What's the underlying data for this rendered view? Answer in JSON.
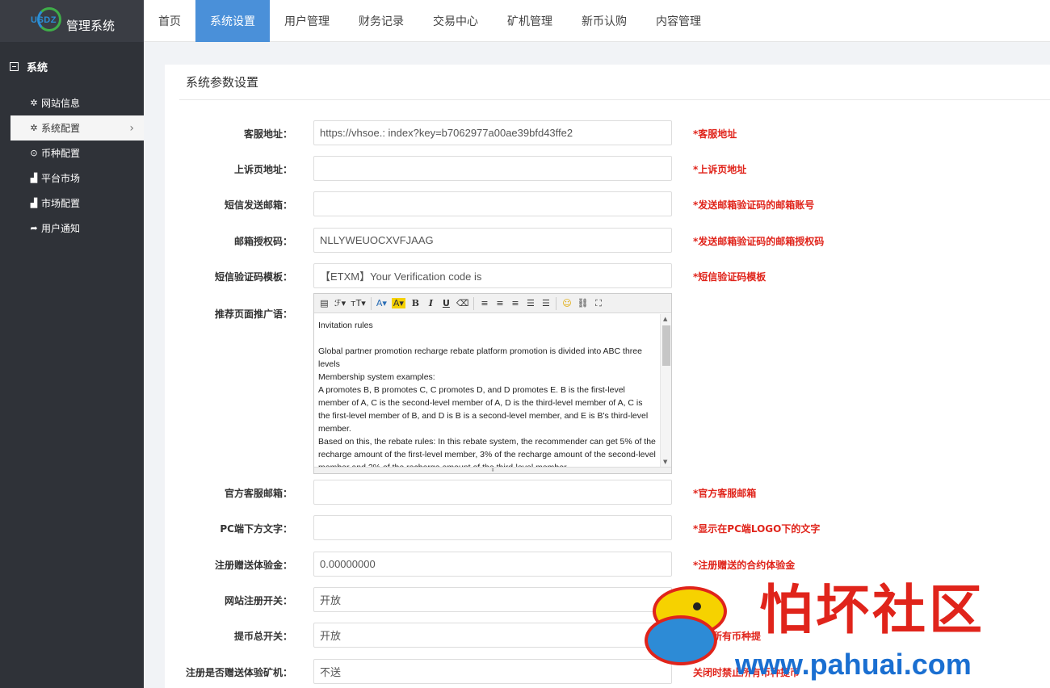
{
  "app": {
    "logo_mark": "USDZ",
    "title": "管理系统"
  },
  "topnav": [
    {
      "label": "首页",
      "active": false
    },
    {
      "label": "系统设置",
      "active": true
    },
    {
      "label": "用户管理",
      "active": false
    },
    {
      "label": "财务记录",
      "active": false
    },
    {
      "label": "交易中心",
      "active": false
    },
    {
      "label": "矿机管理",
      "active": false
    },
    {
      "label": "新币认购",
      "active": false
    },
    {
      "label": "内容管理",
      "active": false
    }
  ],
  "sidebar": {
    "section": "系统",
    "items": [
      {
        "label": "网站信息",
        "icon": "gear-icon"
      },
      {
        "label": "系统配置",
        "icon": "gear-icon"
      },
      {
        "label": "币种配置",
        "icon": "circle-dot-icon"
      },
      {
        "label": "平台市场",
        "icon": "bar-chart-icon"
      },
      {
        "label": "市场配置",
        "icon": "bar-chart-icon"
      },
      {
        "label": "用户通知",
        "icon": "share-icon"
      }
    ]
  },
  "page": {
    "title": "系统参数设置"
  },
  "fields": [
    {
      "label": "客服地址：",
      "value": "https://vhsoe.:                          index?key=b7062977a00ae39bfd43ffe2",
      "hint": "*客服地址"
    },
    {
      "label": "上诉页地址：",
      "value": "",
      "hint": "*上诉页地址"
    },
    {
      "label": "短信发送邮箱：",
      "value": "",
      "hint": "*发送邮箱验证码的邮箱账号"
    },
    {
      "label": "邮箱授权码：",
      "value": "NLLYWEUOCXVFJAAG",
      "hint": "*发送邮箱验证码的邮箱授权码"
    },
    {
      "label": "短信验证码模板：",
      "value": "【ETXM】Your Verification code is",
      "hint": "*短信验证码模板"
    }
  ],
  "editor": {
    "label": "推荐页面推广语：",
    "toolbar": [
      "▤",
      "ℱ▾",
      "ᴛT▾",
      "A▾",
      "A▾",
      "B",
      "I",
      "U",
      "⌫",
      "≡",
      "≡",
      "≡",
      "☰",
      "☰",
      "☺",
      "⛓",
      "⛶"
    ],
    "lines": [
      "Invitation rules",
      "",
      "Global partner promotion recharge rebate platform promotion is divided into ABC three levels",
      "Membership system examples:",
      "A promotes B, B promotes C, C promotes D, and D promotes E. B is the first-level member of A, C is the second-level member of A, D is the third-level member of A, C is the first-level member of B, and D is B is a second-level member, and E is B's third-level member.",
      "Based on this, the rebate rules: In this rebate system, the recommender can get 5% of the recharge amount of the first-level member, 3% of the recharge amount of the second-level member and 2% of the recharge amount of the third-level member."
    ]
  },
  "fields2": [
    {
      "label": "官方客服邮箱：",
      "value": "",
      "hint": "*官方客服邮箱"
    },
    {
      "label": "PC端下方文字：",
      "value": "",
      "hint": "*显示在PC端LOGO下的文字"
    },
    {
      "label": "注册赠送体验金：",
      "value": "0.00000000",
      "hint": "*注册赠送的合约体验金"
    },
    {
      "label": "网站注册开关：",
      "value": "开放",
      "hint": "注册"
    },
    {
      "label": "提币总开关：",
      "value": "开放",
      "hint": "禁止所有币种提"
    },
    {
      "label": "注册是否赠送体验矿机：",
      "value": "不送",
      "hint": "关闭时禁止所有币种提币"
    }
  ],
  "watermark": {
    "cn": "怕坏社区",
    "url": "www.pahuai.com"
  },
  "colors": {
    "sidebar": "#2f3238",
    "accent": "#4a90d9",
    "hint": "#e0241b"
  }
}
